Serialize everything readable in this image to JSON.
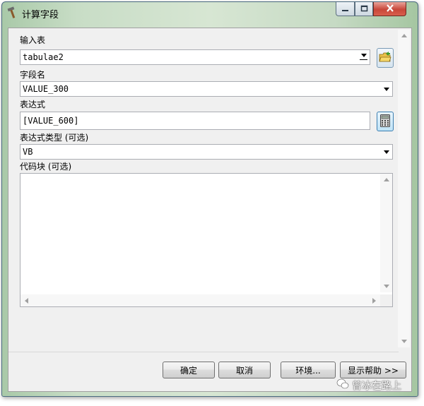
{
  "window": {
    "title": "计算字段"
  },
  "form": {
    "input_table": {
      "label": "输入表",
      "value": "tabulae2"
    },
    "field_name": {
      "label": "字段名",
      "value": "VALUE_300"
    },
    "expression": {
      "label": "表达式",
      "value": "[VALUE_600]"
    },
    "expression_type": {
      "label": "表达式类型 (可选)",
      "value": "VB"
    },
    "code_block": {
      "label": "代码块 (可选)",
      "value": ""
    }
  },
  "buttons": {
    "ok": "确定",
    "cancel": "取消",
    "environments": "环境...",
    "show_help": "显示帮助 >>"
  },
  "watermark": {
    "text": "曾冰在路上"
  },
  "icons": {
    "title": "hammer-icon",
    "browse": "open-folder-icon",
    "calculator": "calculator-icon"
  }
}
